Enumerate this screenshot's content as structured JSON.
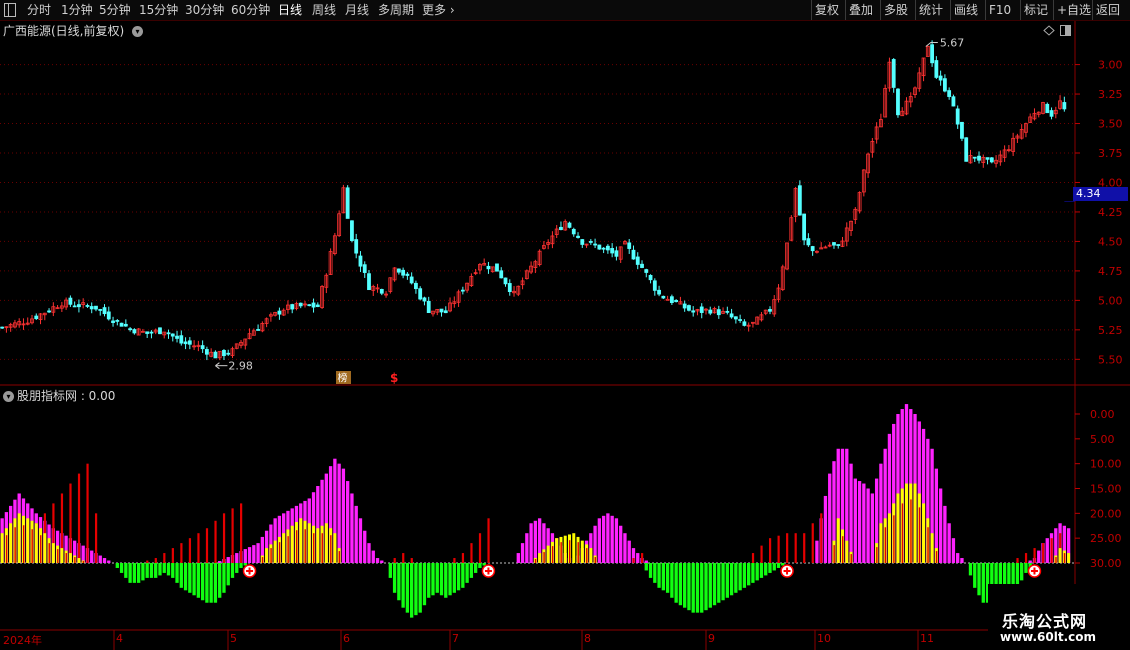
{
  "toolbar": {
    "periods": [
      "分时",
      "1分钟",
      "5分钟",
      "15分钟",
      "30分钟",
      "60分钟",
      "日线",
      "周线",
      "月线",
      "多周期",
      "更多"
    ],
    "active": "日线",
    "right_buttons": [
      "复权",
      "叠加",
      "多股",
      "统计",
      "画线",
      "F10",
      "标记",
      "+自选",
      "返回"
    ]
  },
  "price_panel": {
    "title": "广西能源(日线,前复权)",
    "y_ticks": [
      "5.50",
      "5.25",
      "5.00",
      "4.75",
      "4.50",
      "4.25",
      "4.00",
      "3.75",
      "3.50",
      "3.25",
      "3.00"
    ],
    "current_price": "4.34",
    "high_label": "5.67",
    "low_label": "2.98",
    "badge_bang": "榜",
    "badge_dollar": "$"
  },
  "indicator_panel": {
    "title": "股朋指标网 : 0.00",
    "y_ticks": [
      "30.00",
      "25.00",
      "20.00",
      "15.00",
      "10.00",
      "5.00",
      "0.00"
    ]
  },
  "date_axis": {
    "labels": [
      "2024年",
      "4",
      "5",
      "6",
      "7",
      "8",
      "9",
      "10",
      "11"
    ]
  },
  "watermark": {
    "title": "乐淘公式网",
    "url": "www.60lt.com"
  },
  "colors": {
    "up": "#ff3232",
    "down": "#54ffff",
    "magenta": "#ff22ff",
    "yellow": "#ffff00",
    "red_bar": "#e60000",
    "green_bar": "#11ff11",
    "grid": "#6a0000"
  },
  "chart_data": [
    {
      "type": "candlestick",
      "title": "广西能源(日线,前复权)",
      "ylim": [
        2.85,
        5.7
      ],
      "y_ticks": [
        3.0,
        3.25,
        3.5,
        3.75,
        4.0,
        4.25,
        4.5,
        4.75,
        5.0,
        5.25,
        5.5
      ],
      "x_labels": [
        "2024年",
        "4",
        "5",
        "6",
        "7",
        "8",
        "9",
        "10",
        "11"
      ],
      "annotations": {
        "high": 5.67,
        "low": 2.98,
        "last": 4.34
      },
      "close_path": [
        [
          0,
          3.27
        ],
        [
          6,
          3.33
        ],
        [
          10,
          3.4
        ],
        [
          14,
          3.48
        ],
        [
          18,
          3.46
        ],
        [
          22,
          3.44
        ],
        [
          26,
          3.34
        ],
        [
          30,
          3.26
        ],
        [
          34,
          3.22
        ],
        [
          38,
          3.25
        ],
        [
          42,
          3.14
        ],
        [
          46,
          3.11
        ],
        [
          50,
          3.03
        ],
        [
          54,
          3.07
        ],
        [
          58,
          3.22
        ],
        [
          62,
          3.33
        ],
        [
          66,
          3.43
        ],
        [
          70,
          3.45
        ],
        [
          74,
          3.45
        ],
        [
          76,
          3.74
        ],
        [
          78,
          4.05
        ],
        [
          80,
          4.45
        ],
        [
          82,
          4.0
        ],
        [
          86,
          3.62
        ],
        [
          90,
          3.58
        ],
        [
          92,
          3.8
        ],
        [
          96,
          3.65
        ],
        [
          100,
          3.42
        ],
        [
          104,
          3.4
        ],
        [
          108,
          3.6
        ],
        [
          112,
          3.82
        ],
        [
          116,
          3.76
        ],
        [
          120,
          3.55
        ],
        [
          124,
          3.78
        ],
        [
          128,
          4.0
        ],
        [
          132,
          4.17
        ],
        [
          136,
          4.0
        ],
        [
          140,
          3.95
        ],
        [
          144,
          3.88
        ],
        [
          146,
          3.97
        ],
        [
          150,
          3.78
        ],
        [
          154,
          3.55
        ],
        [
          158,
          3.48
        ],
        [
          162,
          3.4
        ],
        [
          166,
          3.42
        ],
        [
          170,
          3.38
        ],
        [
          174,
          3.28
        ],
        [
          176,
          3.3
        ],
        [
          180,
          3.42
        ],
        [
          182,
          3.62
        ],
        [
          184,
          3.98
        ],
        [
          186,
          4.45
        ],
        [
          188,
          4.0
        ],
        [
          190,
          3.92
        ],
        [
          194,
          3.97
        ],
        [
          196,
          3.95
        ],
        [
          200,
          4.25
        ],
        [
          203,
          4.75
        ],
        [
          206,
          5.05
        ],
        [
          208,
          5.55
        ],
        [
          210,
          5.1
        ],
        [
          213,
          5.2
        ],
        [
          215,
          5.4
        ],
        [
          217,
          5.67
        ],
        [
          219,
          5.4
        ],
        [
          222,
          5.25
        ],
        [
          224,
          5.0
        ],
        [
          226,
          4.7
        ],
        [
          228,
          4.72
        ],
        [
          232,
          4.65
        ],
        [
          236,
          4.8
        ],
        [
          240,
          5.0
        ],
        [
          242,
          5.1
        ],
        [
          244,
          5.15
        ],
        [
          246,
          5.08
        ],
        [
          248,
          5.18
        ],
        [
          250,
          5.05
        ]
      ]
    },
    {
      "type": "bar",
      "title": "股朋指标网 : 0.00",
      "ylim": [
        -11,
        33
      ],
      "y_ticks": [
        0,
        5,
        10,
        15,
        20,
        25,
        30
      ],
      "series": [
        {
          "values": [
            [
              0,
              9
            ],
            [
              4,
              14
            ],
            [
              8,
              10
            ],
            [
              12,
              7
            ],
            [
              16,
              5
            ],
            [
              20,
              3
            ],
            [
              24,
              1
            ],
            [
              26,
              0
            ],
            [
              30,
              0
            ],
            [
              40,
              0
            ],
            [
              50,
              0
            ],
            [
              60,
              4
            ],
            [
              64,
              9
            ],
            [
              68,
              11
            ],
            [
              72,
              13
            ],
            [
              76,
              18
            ],
            [
              78,
              21
            ],
            [
              80,
              19
            ],
            [
              82,
              14
            ],
            [
              84,
              9
            ],
            [
              86,
              4
            ],
            [
              88,
              1
            ],
            [
              90,
              0
            ],
            [
              120,
              0
            ],
            [
              122,
              4
            ],
            [
              124,
              8
            ],
            [
              126,
              9
            ],
            [
              130,
              5
            ],
            [
              132,
              2
            ],
            [
              134,
              0
            ],
            [
              136,
              3
            ],
            [
              138,
              6
            ],
            [
              140,
              9
            ],
            [
              142,
              10
            ],
            [
              144,
              9
            ],
            [
              146,
              6
            ],
            [
              148,
              3
            ],
            [
              150,
              1
            ],
            [
              152,
              0
            ],
            [
              190,
              0
            ],
            [
              192,
              9
            ],
            [
              194,
              18
            ],
            [
              196,
              23
            ],
            [
              198,
              23
            ],
            [
              200,
              17
            ],
            [
              202,
              16
            ],
            [
              204,
              14
            ],
            [
              206,
              20
            ],
            [
              208,
              26
            ],
            [
              210,
              30
            ],
            [
              212,
              32
            ],
            [
              214,
              30
            ],
            [
              216,
              27
            ],
            [
              218,
              23
            ],
            [
              220,
              15
            ],
            [
              222,
              8
            ],
            [
              224,
              2
            ],
            [
              226,
              0
            ],
            [
              240,
              0
            ],
            [
              242,
              1
            ],
            [
              244,
              4
            ],
            [
              246,
              6
            ],
            [
              248,
              8
            ],
            [
              250,
              7
            ]
          ]
        },
        {
          "values": [
            [
              0,
              6
            ],
            [
              4,
              10
            ],
            [
              8,
              8
            ],
            [
              12,
              4
            ],
            [
              16,
              2
            ],
            [
              20,
              0
            ],
            [
              60,
              0
            ],
            [
              62,
              3
            ],
            [
              66,
              6
            ],
            [
              70,
              9
            ],
            [
              74,
              7
            ],
            [
              76,
              8
            ],
            [
              78,
              6
            ],
            [
              80,
              0
            ],
            [
              124,
              0
            ],
            [
              126,
              2
            ],
            [
              130,
              5
            ],
            [
              134,
              6
            ],
            [
              138,
              3
            ],
            [
              140,
              0
            ],
            [
              194,
              0
            ],
            [
              196,
              9
            ],
            [
              200,
              0
            ],
            [
              204,
              0
            ],
            [
              206,
              8
            ],
            [
              208,
              10
            ],
            [
              210,
              14
            ],
            [
              212,
              16
            ],
            [
              214,
              16
            ],
            [
              216,
              12
            ],
            [
              218,
              6
            ],
            [
              220,
              0
            ],
            [
              246,
              0
            ],
            [
              248,
              3
            ],
            [
              250,
              2
            ]
          ]
        },
        {
          "values": [
            [
              0,
              0
            ],
            [
              10,
              10
            ],
            [
              20,
              20
            ],
            [
              24,
              0
            ],
            [
              32,
              0
            ],
            [
              36,
              1
            ],
            [
              40,
              3
            ],
            [
              44,
              5
            ],
            [
              48,
              7
            ],
            [
              52,
              10
            ],
            [
              56,
              12
            ],
            [
              58,
              0
            ],
            [
              74,
              0
            ],
            [
              76,
              3
            ],
            [
              78,
              5
            ],
            [
              80,
              0
            ],
            [
              90,
              0
            ],
            [
              94,
              2
            ],
            [
              98,
              0
            ],
            [
              104,
              0
            ],
            [
              106,
              1
            ],
            [
              108,
              2
            ],
            [
              110,
              4
            ],
            [
              112,
              6
            ],
            [
              114,
              9
            ],
            [
              116,
              0
            ],
            [
              126,
              0
            ],
            [
              130,
              1
            ],
            [
              134,
              4
            ],
            [
              136,
              0
            ],
            [
              146,
              0
            ],
            [
              150,
              2
            ],
            [
              152,
              0
            ],
            [
              174,
              0
            ],
            [
              176,
              2
            ],
            [
              180,
              5
            ],
            [
              184,
              6
            ],
            [
              188,
              6
            ],
            [
              190,
              8
            ],
            [
              192,
              10
            ],
            [
              194,
              0
            ],
            [
              236,
              0
            ],
            [
              238,
              1
            ],
            [
              240,
              2
            ],
            [
              242,
              3
            ],
            [
              244,
              4
            ],
            [
              246,
              5
            ],
            [
              248,
              6
            ],
            [
              250,
              0
            ]
          ]
        },
        {
          "values": [
            [
              0,
              0
            ],
            [
              26,
              0
            ],
            [
              28,
              -2
            ],
            [
              30,
              -4
            ],
            [
              32,
              -4
            ],
            [
              34,
              -3
            ],
            [
              36,
              -3
            ],
            [
              38,
              -2
            ],
            [
              40,
              -3
            ],
            [
              42,
              -5
            ],
            [
              44,
              -6
            ],
            [
              46,
              -7
            ],
            [
              48,
              -8
            ],
            [
              50,
              -8
            ],
            [
              52,
              -6
            ],
            [
              54,
              -3
            ],
            [
              56,
              -1
            ],
            [
              58,
              0
            ],
            [
              90,
              0
            ],
            [
              92,
              -6
            ],
            [
              94,
              -9
            ],
            [
              96,
              -11
            ],
            [
              98,
              -10
            ],
            [
              100,
              -7
            ],
            [
              102,
              -6
            ],
            [
              104,
              -7
            ],
            [
              106,
              -6
            ],
            [
              108,
              -5
            ],
            [
              110,
              -3
            ],
            [
              112,
              -1
            ],
            [
              114,
              0
            ],
            [
              150,
              0
            ],
            [
              152,
              -3
            ],
            [
              154,
              -5
            ],
            [
              156,
              -6
            ],
            [
              158,
              -8
            ],
            [
              160,
              -9
            ],
            [
              162,
              -10
            ],
            [
              164,
              -10
            ],
            [
              166,
              -9
            ],
            [
              168,
              -8
            ],
            [
              170,
              -7
            ],
            [
              172,
              -6
            ],
            [
              174,
              -5
            ],
            [
              176,
              -4
            ],
            [
              178,
              -3
            ],
            [
              180,
              -2
            ],
            [
              182,
              -1
            ],
            [
              184,
              0
            ],
            [
              226,
              0
            ],
            [
              228,
              -5
            ],
            [
              230,
              -8
            ],
            [
              232,
              -8
            ],
            [
              234,
              -8
            ],
            [
              236,
              -7
            ],
            [
              238,
              -5
            ],
            [
              240,
              -2
            ],
            [
              242,
              0
            ],
            [
              250,
              0
            ]
          ]
        }
      ],
      "signals": [
        58,
        114,
        184,
        242
      ]
    }
  ]
}
